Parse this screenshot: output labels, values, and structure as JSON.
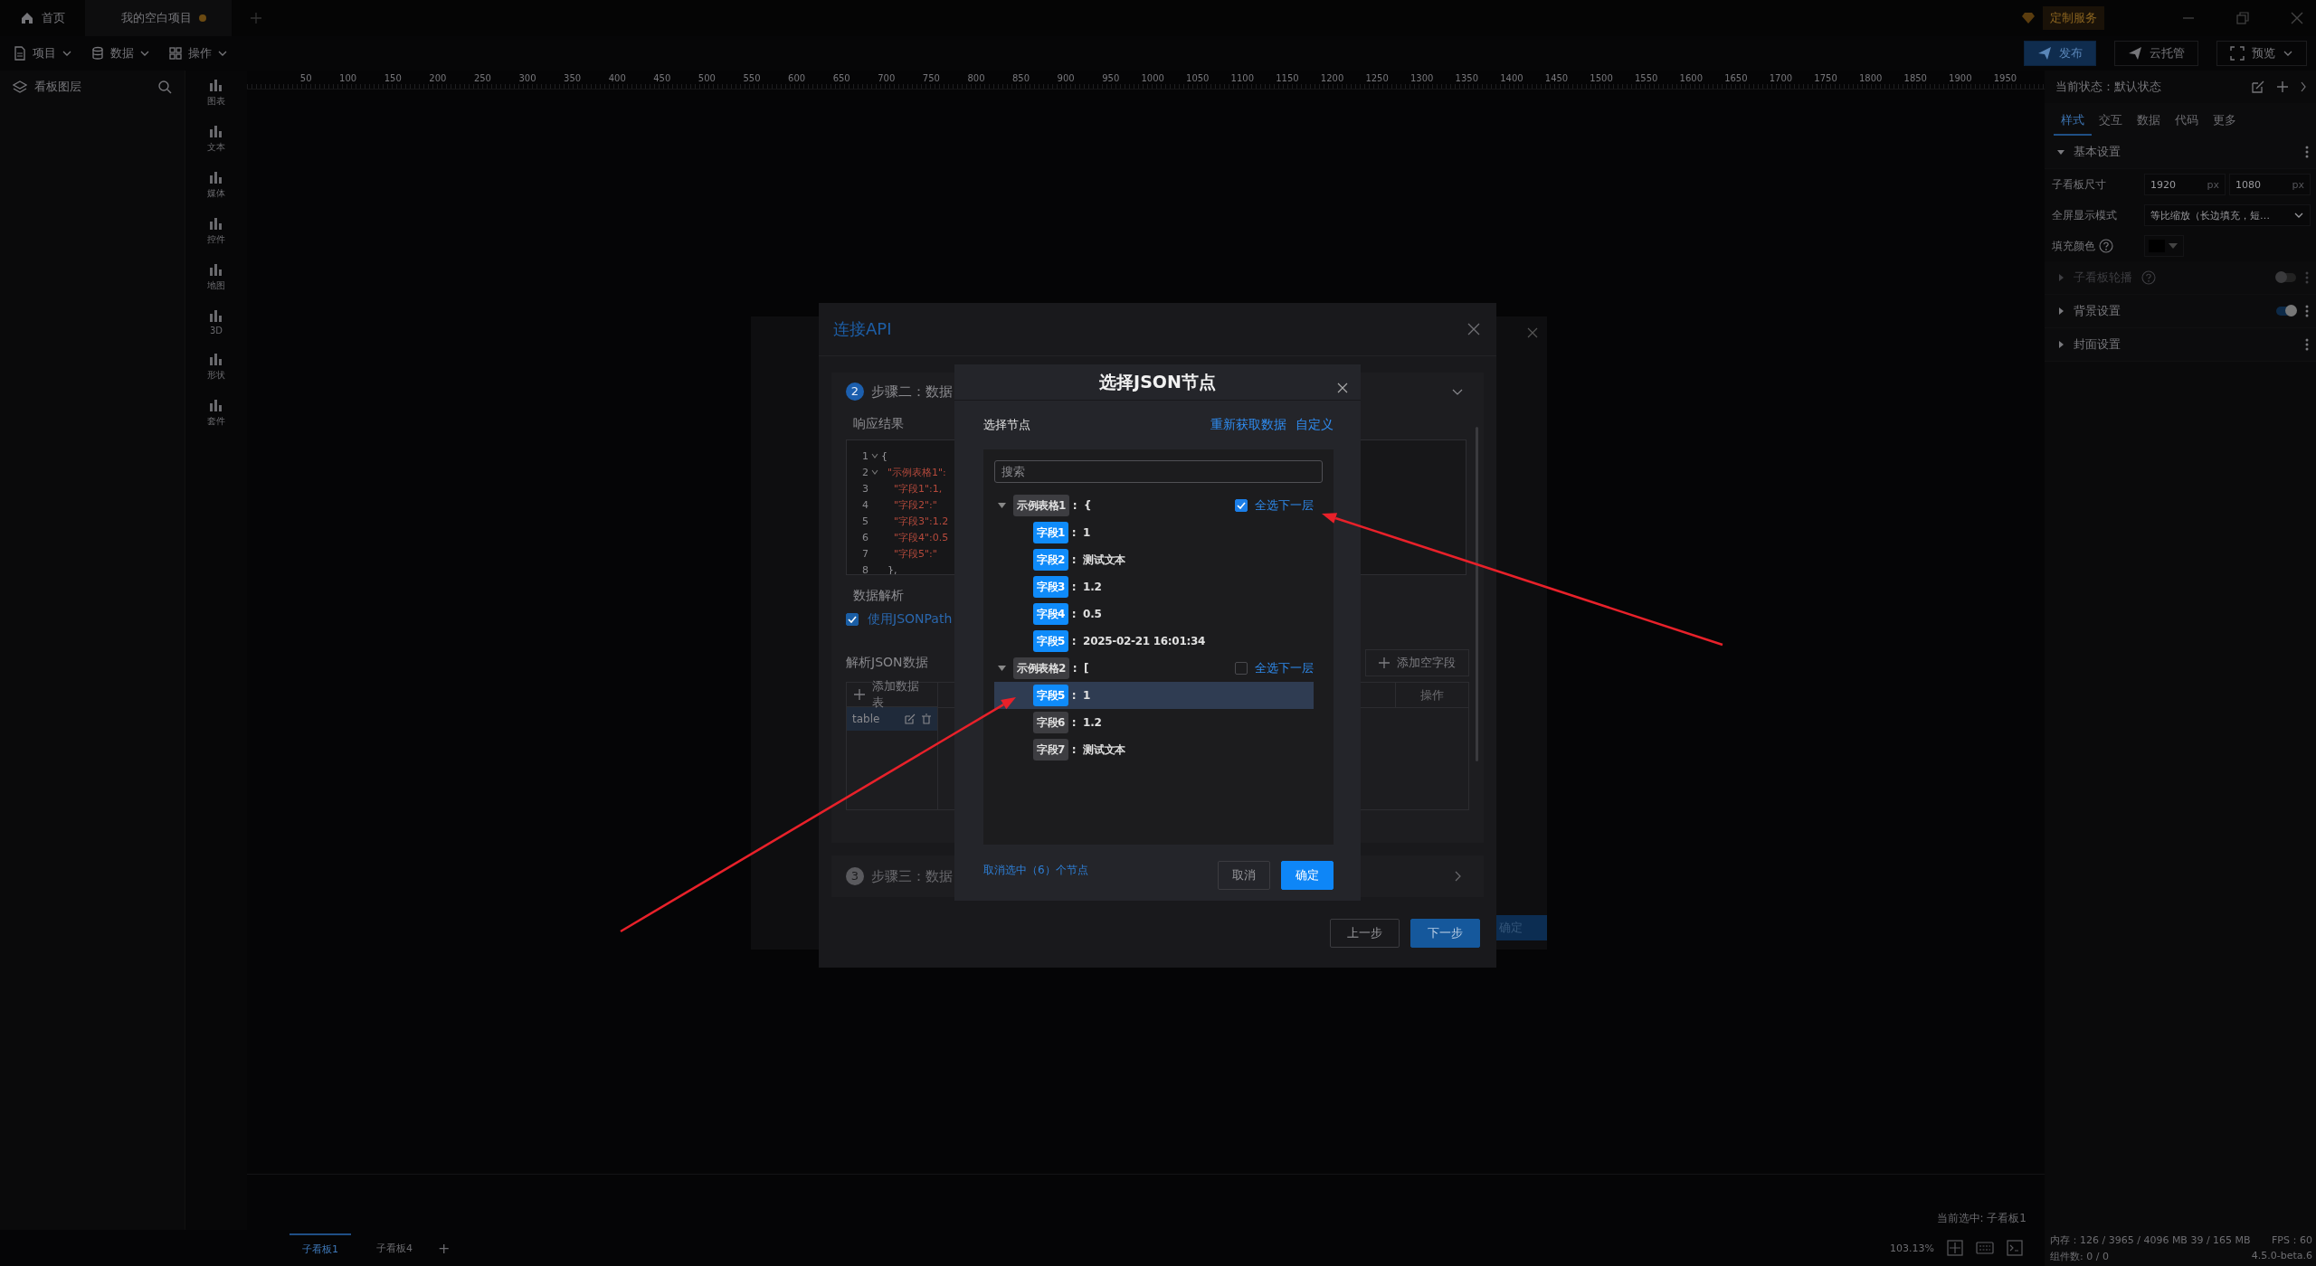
{
  "top_tabs": [
    {
      "label": "首页",
      "kind": "home",
      "selected": false
    },
    {
      "label": "我的空白项目",
      "kind": "project",
      "selected": true,
      "unsaved": true
    }
  ],
  "top_right": {
    "service": "定制服务"
  },
  "menus": [
    {
      "label": "项目",
      "kind": "file"
    },
    {
      "label": "数据",
      "kind": "database"
    },
    {
      "label": "操作",
      "kind": "grid"
    }
  ],
  "actions": [
    {
      "label": "发布",
      "kind": "primary"
    },
    {
      "label": "云托管",
      "kind": "plain"
    },
    {
      "label": "预览",
      "kind": "dropdown"
    }
  ],
  "layers_panel": {
    "title": "看板图层"
  },
  "toolbox": [
    "图表",
    "文本",
    "媒体",
    "控件",
    "地图",
    "3D",
    "形状",
    "套件"
  ],
  "ruler": [
    "50",
    "100",
    "150",
    "200",
    "250",
    "300",
    "350",
    "400",
    "450",
    "500",
    "550",
    "600",
    "650",
    "700",
    "750",
    "800",
    "850",
    "900",
    "950",
    "1000",
    "1050",
    "1100",
    "1150",
    "1200",
    "1250",
    "1300",
    "1350",
    "1400",
    "1450",
    "1500",
    "1550",
    "1600",
    "1650",
    "1700",
    "1750",
    "1800",
    "1850",
    "1900",
    "1950"
  ],
  "selection_label": "当前选中: 子看板1",
  "inspector": {
    "state_label": "当前状态：默认状态",
    "tabs": [
      {
        "label": "样式",
        "selected": true
      },
      {
        "label": "交互",
        "selected": false
      },
      {
        "label": "数据",
        "selected": false
      },
      {
        "label": "代码",
        "selected": false
      },
      {
        "label": "更多",
        "selected": false
      }
    ],
    "sections": [
      {
        "title": "基本设置",
        "expanded": true,
        "disabled": false,
        "help": false,
        "rows": [
          {
            "kind": "size",
            "label": "子看板尺寸",
            "fields": [
              {
                "value": "1920",
                "unit": "px"
              },
              {
                "value": "1080",
                "unit": "px"
              }
            ]
          },
          {
            "kind": "select",
            "label": "全屏显示模式",
            "value": "等比缩放（长边填充，短…"
          },
          {
            "kind": "color",
            "label": "填充颜色",
            "help": true
          }
        ]
      },
      {
        "title": "子看板轮播",
        "expanded": false,
        "disabled": true,
        "help": true,
        "toggle": {
          "on": false
        }
      },
      {
        "title": "背景设置",
        "expanded": false,
        "disabled": false,
        "help": false,
        "toggle": {
          "on": true
        }
      },
      {
        "title": "封面设置",
        "expanded": false,
        "disabled": false,
        "help": false
      }
    ]
  },
  "bottom_bar": {
    "tabs": [
      {
        "label": "子看板1",
        "selected": true
      },
      {
        "label": "子看板4",
        "selected": false
      }
    ],
    "add": "+",
    "zoom": "103.13%",
    "memory": "内存：126 / 3965 / 4096 MB  39 / 165 MB",
    "fps": "FPS：60",
    "count": "组件数: 0 / 0",
    "version": "4.5.0-beta.6"
  },
  "back_dialog": {
    "confirm": "确定"
  },
  "api_dialog": {
    "title": "连接API",
    "steps": [
      {
        "number": "2",
        "title": "步骤二：数据",
        "active": true
      },
      {
        "number": "3",
        "title": "步骤三：数据",
        "active": false
      }
    ],
    "response_label": "响应结果",
    "code": [
      {
        "line": "1",
        "text": "{",
        "fold": true
      },
      {
        "line": "2",
        "text": "\"示例表格1\":",
        "fold": true
      },
      {
        "line": "3",
        "text": "\"字段1\":1,",
        "fold": false
      },
      {
        "line": "4",
        "text": "\"字段2\":\"",
        "fold": false
      },
      {
        "line": "5",
        "text": "\"字段3\":1.2",
        "fold": false
      },
      {
        "line": "6",
        "text": "\"字段4\":0.5",
        "fold": false
      },
      {
        "line": "7",
        "text": "\"字段5\":\"",
        "fold": false
      },
      {
        "line": "8",
        "text": "},",
        "fold": false
      }
    ],
    "parse_label": "数据解析",
    "jsonpath": {
      "label": "使用JSONPath",
      "checked": true
    },
    "parse_json_label": "解析JSON数据",
    "add_field": "添加空字段",
    "add_table": "添加数据表",
    "tables": [
      {
        "name": "table",
        "selected": true
      }
    ],
    "ops_header": "操作",
    "buttons": [
      {
        "label": "上一步",
        "kind": "plain"
      },
      {
        "label": "下一步",
        "kind": "primary"
      }
    ]
  },
  "json_dialog": {
    "title": "选择JSON节点",
    "section_label": "选择节点",
    "links": [
      "重新获取数据",
      "自定义"
    ],
    "search": {
      "placeholder": "搜索"
    },
    "tree": [
      {
        "key": "示例表格1",
        "bracket": ":  {",
        "expanded": true,
        "select_all": {
          "label": "全选下一层",
          "checked": true
        },
        "children": [
          {
            "key": "字段1",
            "value": ":  1",
            "checked": true,
            "selected": false
          },
          {
            "key": "字段2",
            "value": ":  测试文本",
            "checked": true,
            "selected": false
          },
          {
            "key": "字段3",
            "value": ":  1.2",
            "checked": true,
            "selected": false
          },
          {
            "key": "字段4",
            "value": ":  0.5",
            "checked": true,
            "selected": false
          },
          {
            "key": "字段5",
            "value": ":  2025-02-21 16:01:34",
            "checked": true,
            "selected": false
          }
        ]
      },
      {
        "key": "示例表格2",
        "bracket": ":  [",
        "expanded": true,
        "select_all": {
          "label": "全选下一层",
          "checked": false
        },
        "children": [
          {
            "key": "字段5",
            "value": ":  1",
            "checked": true,
            "selected": true
          },
          {
            "key": "字段6",
            "value": ":  1.2",
            "checked": false,
            "selected": false
          },
          {
            "key": "字段7",
            "value": ":  测试文本",
            "checked": false,
            "selected": false
          }
        ]
      }
    ],
    "deselect_link": "取消选中（6）个节点",
    "buttons": [
      {
        "label": "取消",
        "kind": "plain"
      },
      {
        "label": "确定",
        "kind": "primary"
      }
    ]
  },
  "annotation_arrows": [
    {
      "kind": "arrow"
    },
    {
      "kind": "arrow"
    }
  ]
}
